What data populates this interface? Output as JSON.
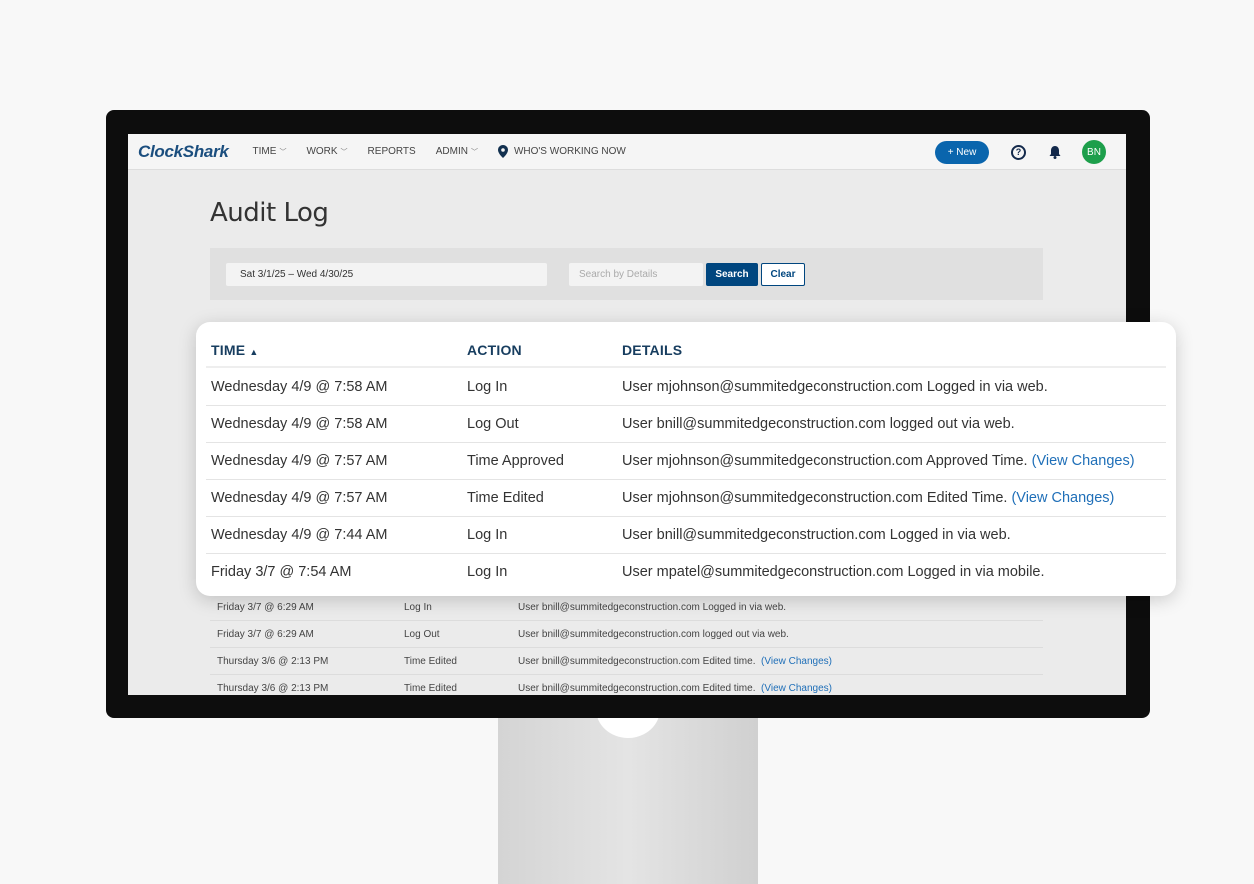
{
  "nav": {
    "logo": "ClockShark",
    "items": [
      {
        "label": "TIME",
        "dropdown": true
      },
      {
        "label": "WORK",
        "dropdown": true
      },
      {
        "label": "REPORTS",
        "dropdown": false
      },
      {
        "label": "ADMIN",
        "dropdown": true
      }
    ],
    "whos_working": "WHO'S WORKING NOW",
    "new_button": "+ New",
    "help": "?",
    "avatar": "BN"
  },
  "page": {
    "title": "Audit Log"
  },
  "filters": {
    "date_range": "Sat 3/1/25 – Wed 4/30/25",
    "search_placeholder": "Search by Details",
    "search_button": "Search",
    "clear_button": "Clear"
  },
  "table": {
    "headers": {
      "time": "TIME",
      "action": "ACTION",
      "details": "DETAILS"
    },
    "sort_icon": "▲",
    "rows": [
      {
        "time": "Wednesday 4/9 @ 7:58 AM",
        "action": "Log In",
        "details": "User mjohnson@summitedgeconstruction.com Logged in via web.",
        "link": ""
      },
      {
        "time": "Wednesday 4/9 @ 7:58 AM",
        "action": "Log Out",
        "details": "User bnill@summitedgeconstruction.com logged out via web.",
        "link": ""
      },
      {
        "time": "Wednesday 4/9 @ 7:57 AM",
        "action": "Time Approved",
        "details": "User mjohnson@summitedgeconstruction.com Approved Time. ",
        "link": "(View Changes)"
      },
      {
        "time": "Wednesday 4/9 @ 7:57 AM",
        "action": "Time Edited",
        "details": "User mjohnson@summitedgeconstruction.com Edited Time. ",
        "link": "(View Changes)"
      },
      {
        "time": "Wednesday 4/9 @ 7:44 AM",
        "action": "Log In",
        "details": "User bnill@summitedgeconstruction.com Logged in via web.",
        "link": ""
      },
      {
        "time": "Friday 3/7 @ 7:54 AM",
        "action": "Log In",
        "details": "User mpatel@summitedgeconstruction.com Logged in via mobile.",
        "link": ""
      }
    ],
    "background_rows": [
      {
        "time": "Friday 3/7 @ 6:29 AM",
        "action": "Log In",
        "details": "User bnill@summitedgeconstruction.com Logged in via web.",
        "link": ""
      },
      {
        "time": "Friday 3/7 @ 6:29 AM",
        "action": "Log Out",
        "details": "User bnill@summitedgeconstruction.com logged out via web.",
        "link": ""
      },
      {
        "time": "Thursday 3/6 @ 2:13 PM",
        "action": "Time Edited",
        "details": "User bnill@summitedgeconstruction.com Edited time.  ",
        "link": "(View Changes)"
      },
      {
        "time": "Thursday 3/6 @ 2:13 PM",
        "action": "Time Edited",
        "details": "User bnill@summitedgeconstruction.com Edited time.  ",
        "link": "(View Changes)"
      }
    ]
  },
  "colors": {
    "brand": "#1b4e7e",
    "button": "#00467f",
    "link": "#1f6fb8",
    "avatar": "#1d9f4b"
  }
}
